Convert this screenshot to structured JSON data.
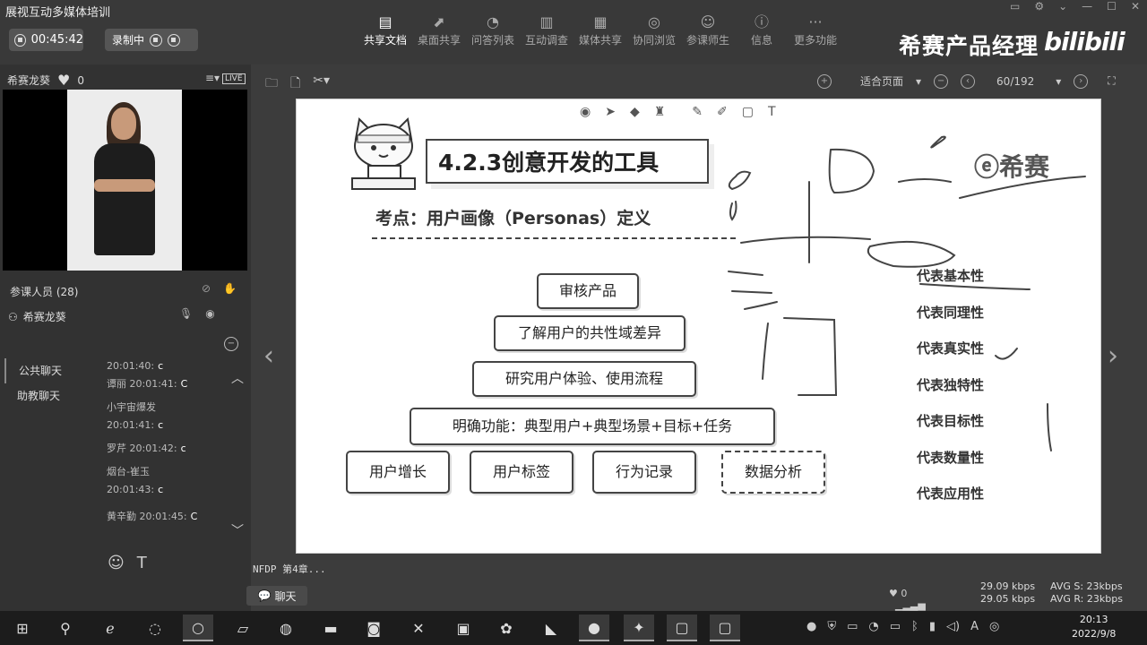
{
  "app": {
    "title": "展视互动多媒体培训"
  },
  "session": {
    "timer": "00:45:42",
    "recording_label": "录制中"
  },
  "toolbar": {
    "items": [
      {
        "label": "共享文档",
        "icon": "doc-share-icon"
      },
      {
        "label": "桌面共享",
        "icon": "desktop-share-icon"
      },
      {
        "label": "问答列表",
        "icon": "qa-icon"
      },
      {
        "label": "互动调查",
        "icon": "survey-icon"
      },
      {
        "label": "媒体共享",
        "icon": "media-icon"
      },
      {
        "label": "协同浏览",
        "icon": "browse-icon"
      },
      {
        "label": "参课师生",
        "icon": "users-icon"
      },
      {
        "label": "信息",
        "icon": "info-icon"
      },
      {
        "label": "更多功能",
        "icon": "more-icon"
      }
    ]
  },
  "brand": {
    "name": "希赛产品经理",
    "logo": "bilibili"
  },
  "host": {
    "name": "希赛龙葵",
    "likes": "0",
    "live_badge": "LIVE"
  },
  "participants": {
    "label": "参课人员 (28)",
    "user": "希赛龙葵"
  },
  "chat": {
    "tabs": [
      "公共聊天",
      "助教聊天"
    ],
    "messages": [
      {
        "name": "",
        "time": "20:01:40:",
        "text": "c"
      },
      {
        "name": "谭丽",
        "time": "20:01:41:",
        "text": "C"
      },
      {
        "name": "小宇宙爆发",
        "time": "20:01:41:",
        "text": "c"
      },
      {
        "name": "罗芹",
        "time": "20:01:42:",
        "text": "c"
      },
      {
        "name": "烟台-崔玉",
        "time": "20:01:43:",
        "text": "c"
      },
      {
        "name": "黄辛勤",
        "time": "20:01:45:",
        "text": "C"
      }
    ],
    "button_label": "聊天"
  },
  "document": {
    "zoom": "适合页面",
    "page": "60/192",
    "footer": "NFDP 第4章..."
  },
  "slide": {
    "title": "4.2.3创意开发的工具",
    "subtitle": "考点：用户画像（Personas）定义",
    "nodes": {
      "audit": "审核产品",
      "understand": "了解用户的共性域差异",
      "research": "研究用户体验、使用流程",
      "clarify": "明确功能：典型用户+典型场景+目标+任务",
      "growth": "用户增长",
      "tags": "用户标签",
      "behavior": "行为记录",
      "analysis": "数据分析"
    },
    "represents": [
      "代表基本性",
      "代表同理性",
      "代表真实性",
      "代表独特性",
      "代表目标性",
      "代表数量性",
      "代表应用性"
    ],
    "logo": "希赛"
  },
  "stats": {
    "likes": "0",
    "up": "29.09 kbps",
    "down": "29.05 kbps",
    "avg_s": "AVG S: 23kbps",
    "avg_r": "AVG R: 23kbps"
  },
  "taskbar": {
    "time": "20:13",
    "date": "2022/9/8"
  }
}
